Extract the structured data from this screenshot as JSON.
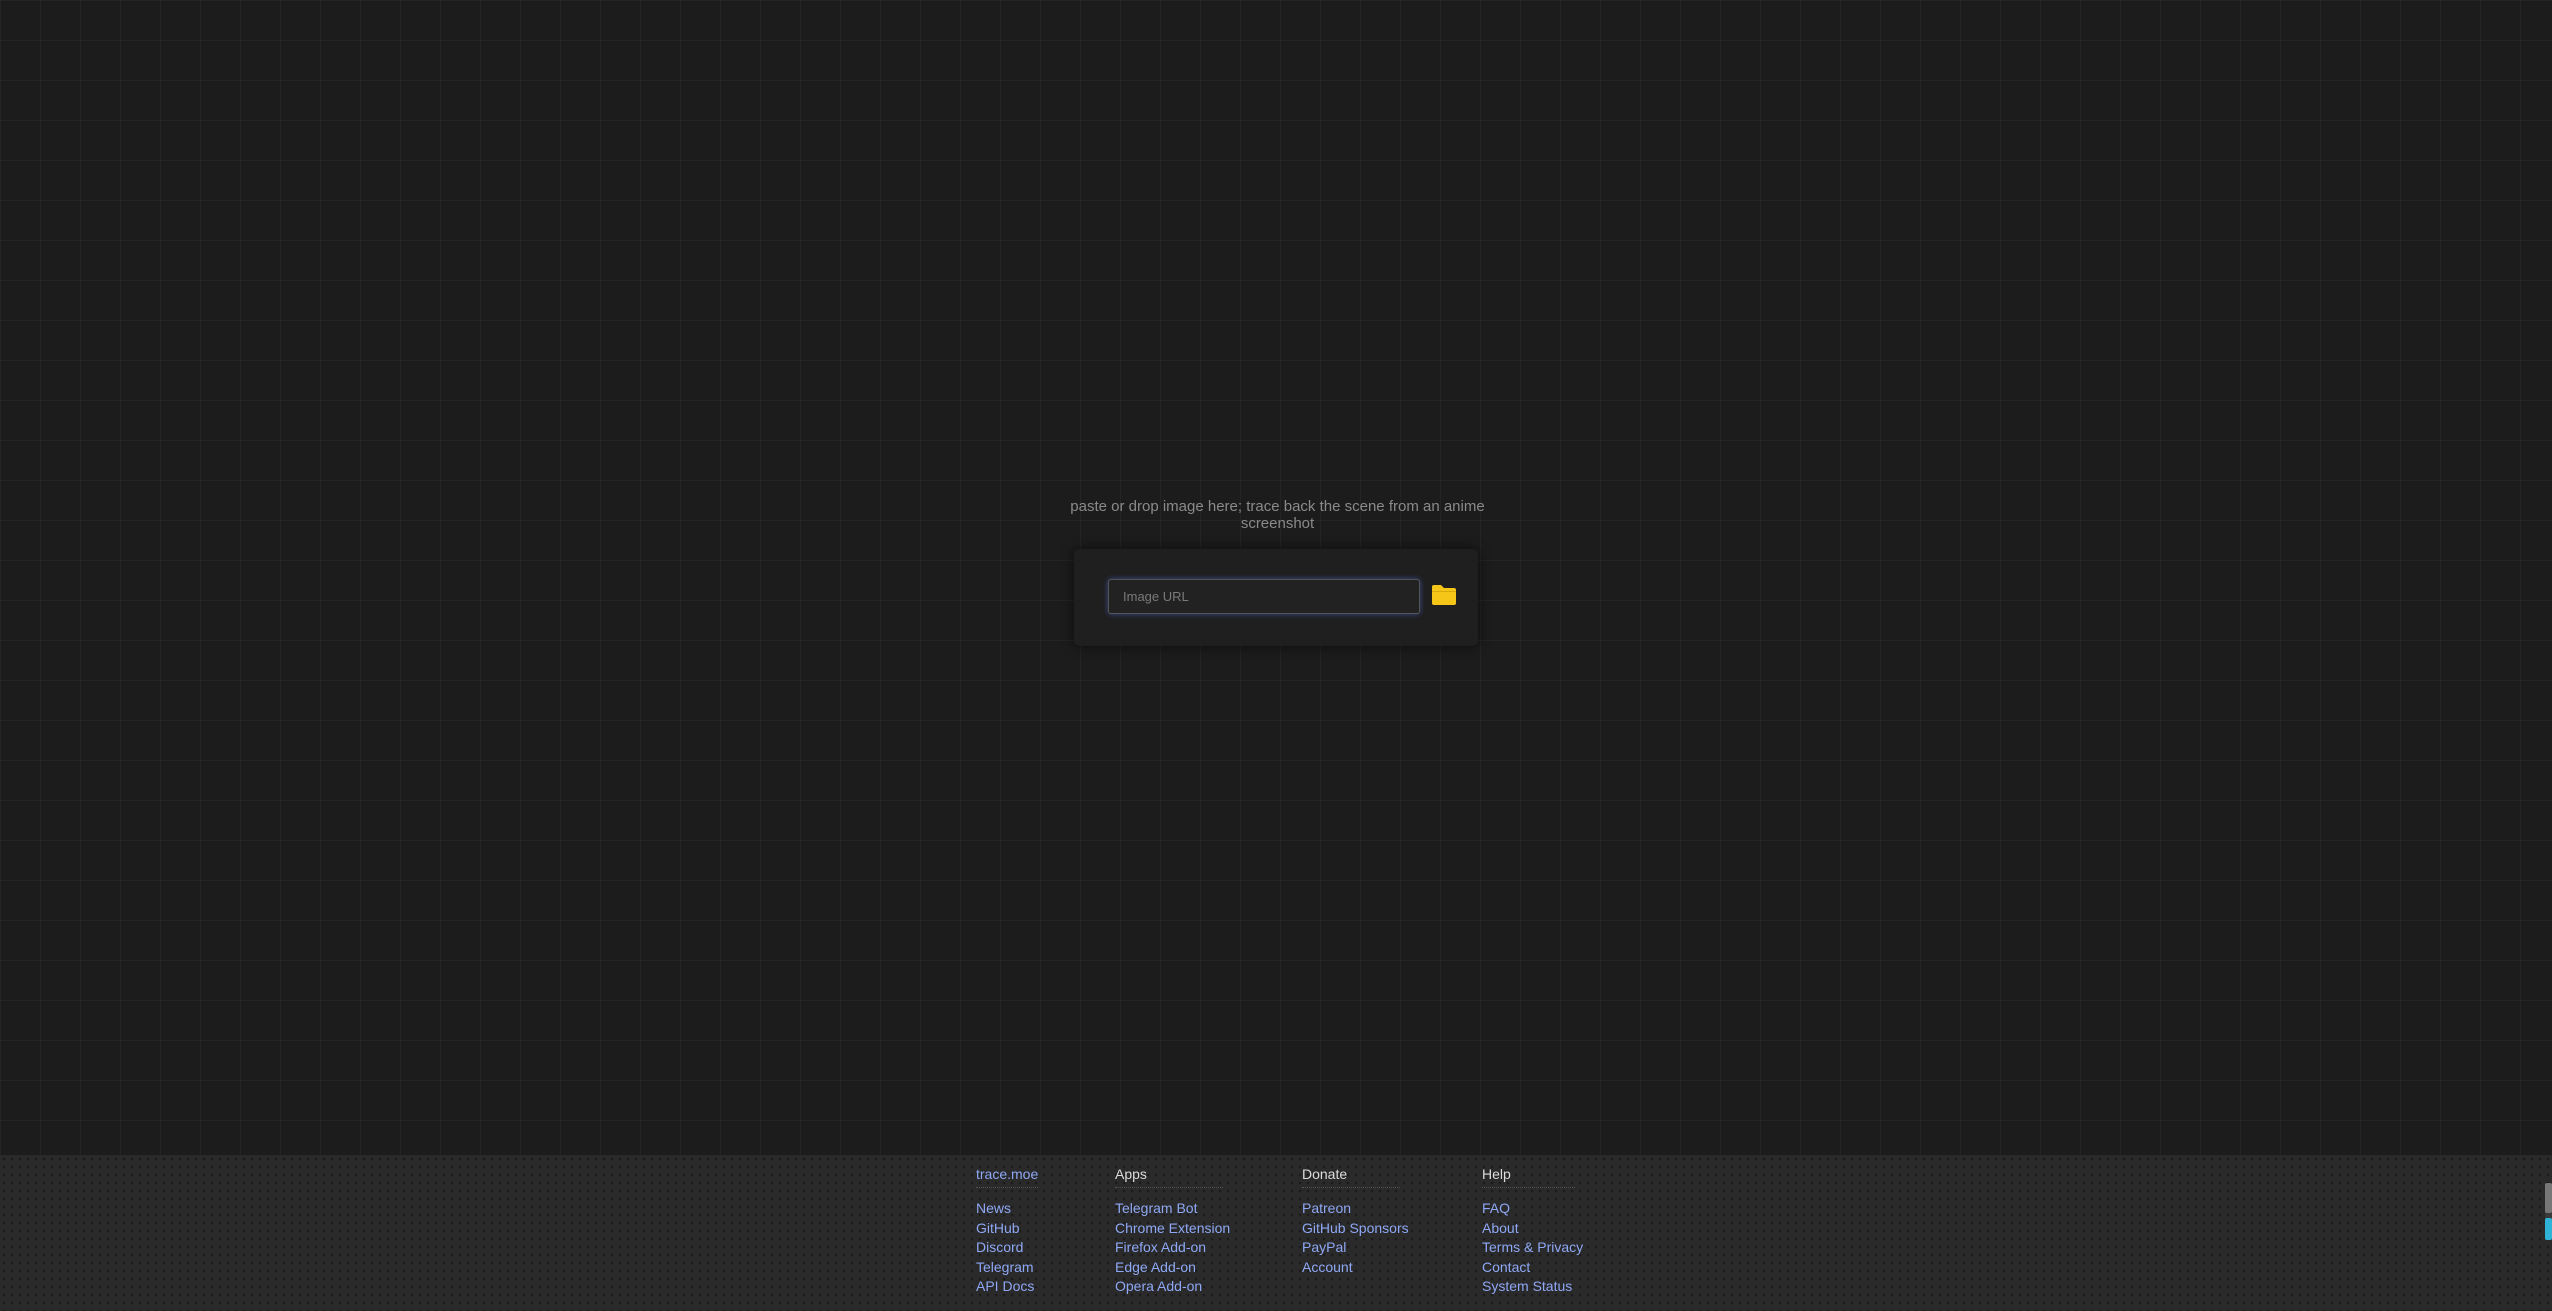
{
  "search": {
    "hint": "paste or drop image here; trace back the scene from an anime screenshot",
    "url_placeholder": "Image URL",
    "file_icon": "folder-icon",
    "icon_color": "#f5c518"
  },
  "footer": {
    "columns": [
      {
        "title": "trace.moe",
        "links": [
          "News",
          "GitHub",
          "Discord",
          "Telegram",
          "API Docs"
        ]
      },
      {
        "title": "Apps",
        "links": [
          "Telegram Bot",
          "Chrome Extension",
          "Firefox Add-on",
          "Edge Add-on",
          "Opera Add-on"
        ]
      },
      {
        "title": "Donate",
        "links": [
          "Patreon",
          "GitHub Sponsors",
          "PayPal",
          "Account"
        ]
      },
      {
        "title": "Help",
        "links": [
          "FAQ",
          "About",
          "Terms & Privacy",
          "Contact",
          "System Status"
        ]
      }
    ]
  },
  "colors": {
    "background": "#1c1c1c",
    "link": "#8fa8f5",
    "footer_bg": "#2a2a2a"
  }
}
